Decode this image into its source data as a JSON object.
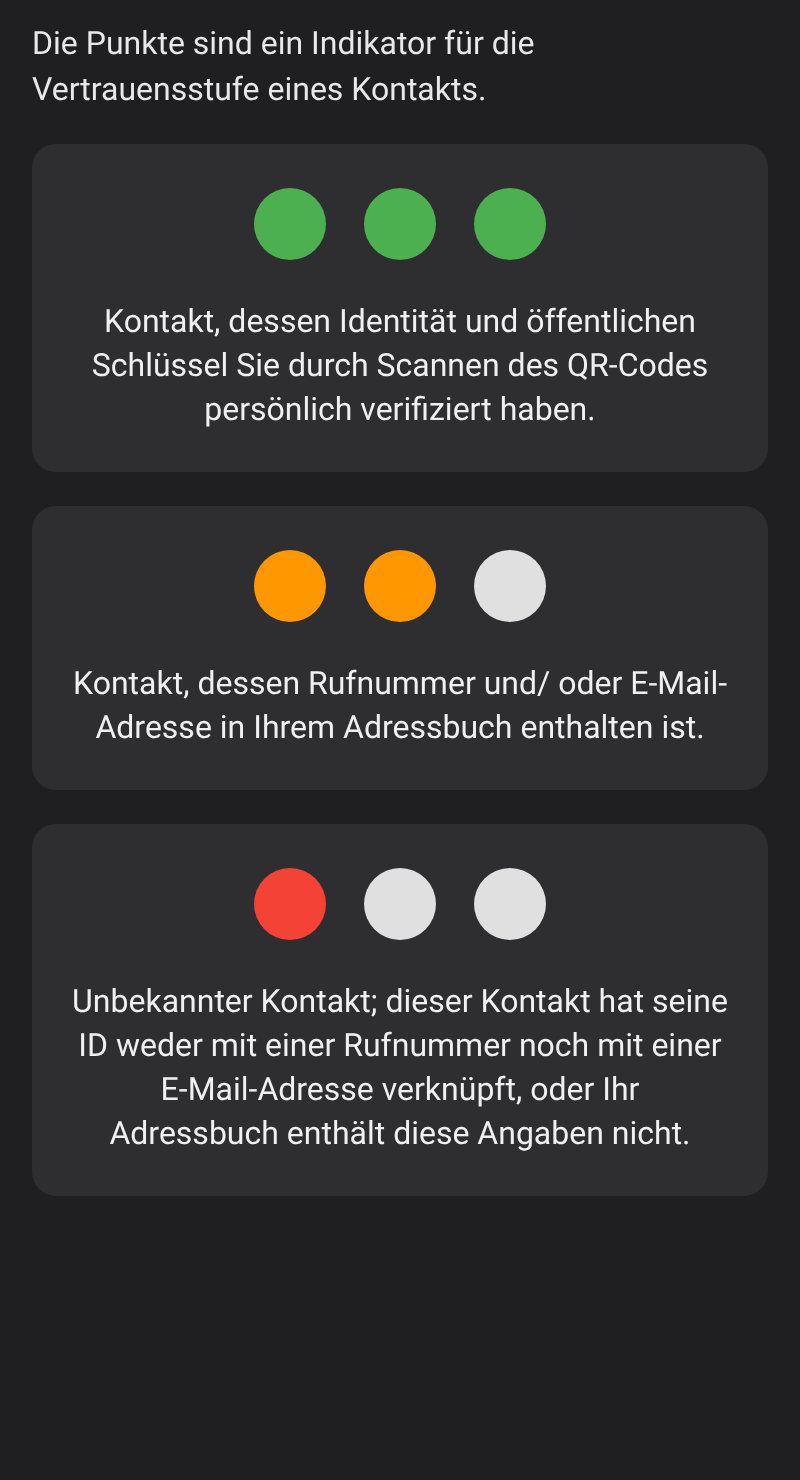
{
  "intro": "Die Punkte sind ein Indikator für die Vertrauensstufe eines Kontakts.",
  "levels": [
    {
      "dots": [
        {
          "color": "#4caf50"
        },
        {
          "color": "#4caf50"
        },
        {
          "color": "#4caf50"
        }
      ],
      "description": "Kontakt, dessen Identität und öffentlichen Schlüssel Sie durch Scannen des QR-Codes persönlich verifiziert haben."
    },
    {
      "dots": [
        {
          "color": "#ff9800"
        },
        {
          "color": "#ff9800"
        },
        {
          "color": "#e0e0e0"
        }
      ],
      "description": "Kontakt, dessen Rufnummer und/ oder E-Mail-Adresse in Ihrem Adressbuch enthalten ist."
    },
    {
      "dots": [
        {
          "color": "#f44336"
        },
        {
          "color": "#e0e0e0"
        },
        {
          "color": "#e0e0e0"
        }
      ],
      "description": "Unbekannter Kontakt; dieser Kontakt hat seine ID weder mit einer Rufnummer noch mit einer E-Mail-Adresse verknüpft, oder Ihr Adressbuch enthält diese Angaben nicht."
    }
  ]
}
